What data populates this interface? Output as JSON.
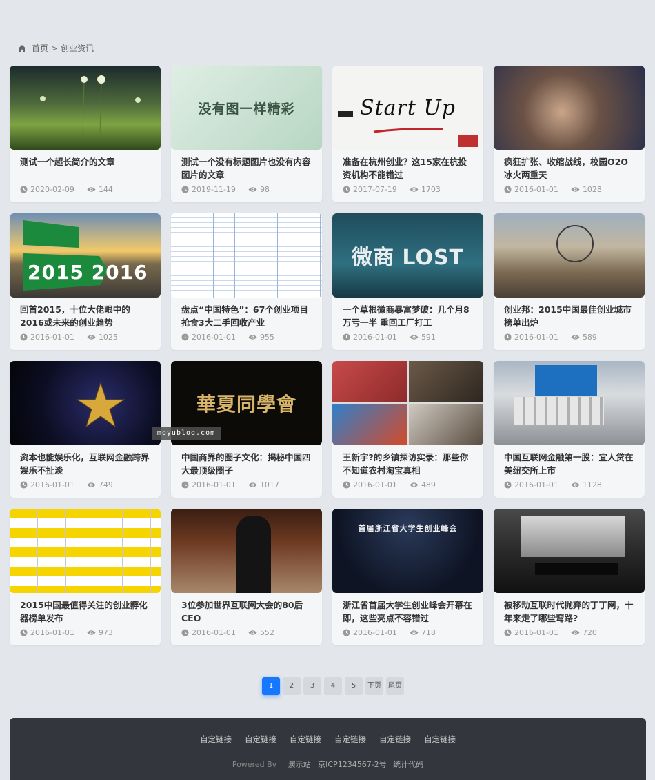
{
  "breadcrumb": {
    "home": "首页",
    "separator": ">",
    "current": "创业资讯",
    "icon": "home-icon"
  },
  "articles": [
    {
      "title": "测试一个超长简介的文章",
      "date": "2020-02-09",
      "views": "144"
    },
    {
      "title": "测试一个没有标题图片也没有内容图片的文章",
      "date": "2019-11-19",
      "views": "98",
      "thumb_text": "没有图一样精彩"
    },
    {
      "title": "准备在杭州创业？这15家在杭投资机构不能错过",
      "date": "2017-07-19",
      "views": "1703",
      "thumb_text": "Start Up"
    },
    {
      "title": "疯狂扩张、收缩战线，校园O2O冰火两重天",
      "date": "2016-01-01",
      "views": "1028"
    },
    {
      "title": "回首2015，十位大佬眼中的2016或未来的创业趋势",
      "date": "2016-01-01",
      "views": "1025",
      "thumb_text": "2015 2016"
    },
    {
      "title": "盘点“中国特色”：67个创业项目抢食3大二手回收产业",
      "date": "2016-01-01",
      "views": "955"
    },
    {
      "title": "一个草根微商暴富梦破：几个月8万亏一半 重回工厂打工",
      "date": "2016-01-01",
      "views": "591",
      "thumb_text": "微商 LOST"
    },
    {
      "title": "创业邦：2015中国最佳创业城市榜单出炉",
      "date": "2016-01-01",
      "views": "589"
    },
    {
      "title": "资本也能娱乐化，互联网金融跨界娱乐不扯淡",
      "date": "2016-01-01",
      "views": "749"
    },
    {
      "title": "中国商界的圈子文化：揭秘中国四大最顶级圈子",
      "date": "2016-01-01",
      "views": "1017",
      "thumb_text": "華夏同學會"
    },
    {
      "title": "王新宇?的乡镇探访实录：那些你不知道农村淘宝真相",
      "date": "2016-01-01",
      "views": "489"
    },
    {
      "title": "中国互联网金融第一股：宜人贷在美纽交所上市",
      "date": "2016-01-01",
      "views": "1128"
    },
    {
      "title": "2015中国最值得关注的创业孵化器榜单发布",
      "date": "2016-01-01",
      "views": "973"
    },
    {
      "title": "3位参加世界互联网大会的80后CEO",
      "date": "2016-01-01",
      "views": "552"
    },
    {
      "title": "浙江省首届大学生创业峰会开幕在即，这些亮点不容错过",
      "date": "2016-01-01",
      "views": "718",
      "thumb_text": "首届浙江省大学生创业峰会"
    },
    {
      "title": "被移动互联时代抛弃的丁丁网，十年来走了哪些弯路?",
      "date": "2016-01-01",
      "views": "720"
    }
  ],
  "watermark": "moyublog.com",
  "pagination": {
    "pages": [
      "1",
      "2",
      "3",
      "4",
      "5"
    ],
    "current": "1",
    "next": "下页",
    "last": "尾页"
  },
  "footer": {
    "links": [
      "自定链接",
      "自定链接",
      "自定链接",
      "自定链接",
      "自定链接",
      "自定链接"
    ],
    "powered_by": "Powered By",
    "site": "演示站",
    "icp": "京ICP1234567-2号",
    "stats": "统计代码"
  },
  "colors": {
    "background": "#e3e6eb",
    "accent": "#1677ff",
    "footer": "#33363d"
  }
}
